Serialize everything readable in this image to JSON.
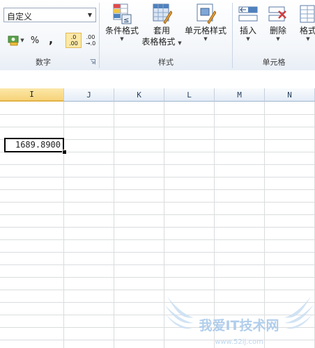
{
  "number_group": {
    "format_value": "自定义",
    "percent_label": "%",
    "comma_label": ",",
    "increase_decimal_top": ".0",
    "increase_decimal_bottom": ".00",
    "decrease_decimal_top": ".00",
    "decrease_decimal_bottom": "→.0",
    "group_label": "数字"
  },
  "styles_group": {
    "conditional_format_label": "条件格式",
    "table_format_line1": "套用",
    "table_format_line2": "表格格式",
    "cell_styles_label": "单元格样式",
    "group_label": "样式"
  },
  "cells_group": {
    "insert_label": "插入",
    "delete_label": "删除",
    "format_label": "格式",
    "group_label": "单元格"
  },
  "sheet": {
    "columns": [
      "I",
      "J",
      "K",
      "L",
      "M",
      "N"
    ],
    "selected_column": "I",
    "active_cell_value": "1689.8900"
  },
  "watermark": {
    "text": "我爱IT技术网",
    "url": "www.52ij.com"
  },
  "colors": {
    "selected_header": "#f7d37a",
    "grid_line": "#dadcdd",
    "ribbon_bg": "#f3f6fa"
  }
}
